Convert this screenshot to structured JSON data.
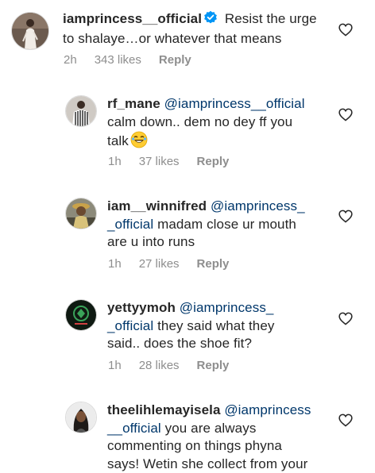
{
  "comments": [
    {
      "username": "iamprincess__official",
      "verified": true,
      "mention": "",
      "text": "Resist the urge to shalaye…or whatever that means",
      "line1_text": "Resist the urge",
      "line2_text": "to shalaye…or whatever that means",
      "time": "2h",
      "likes": "343 likes",
      "reply_label": "Reply",
      "avatar_icon": "profile-photo-woman-white-dress"
    },
    {
      "username": "rf_mane",
      "mention": "@iamprincess__official",
      "line1_text": "calm down.. dem no dey ff you",
      "line2_text": "talk",
      "emoji": "laughing-emoji",
      "time": "1h",
      "likes": "37 likes",
      "reply_label": "Reply",
      "avatar_icon": "profile-photo-man-striped-shirt"
    },
    {
      "username": "iam__winnifred",
      "mention_part1": "@iamprincess_",
      "mention_part2": "_official",
      "line1_text": "madam close ur mouth",
      "line2_text": "are u into runs",
      "time": "1h",
      "likes": "27 likes",
      "reply_label": "Reply",
      "avatar_icon": "profile-photo-person-hat"
    },
    {
      "username": "yettyymoh",
      "mention_part1": "@iamprincess_",
      "mention_part2": "_official",
      "line1_text": "they said what they",
      "line2_text": "said.. does the shoe fit?",
      "time": "1h",
      "likes": "28 likes",
      "reply_label": "Reply",
      "avatar_icon": "profile-photo-dark-logo"
    },
    {
      "username": "theelihlemayisela",
      "mention_part1": "@iamprincess",
      "mention_part2": "__official",
      "line1_text": "you are always",
      "line2_text": "commenting on things phyna",
      "line3_text": "says! Wetin she collect from your",
      "avatar_icon": "profile-photo-woman-portrait"
    }
  ],
  "colors": {
    "text": "#262626",
    "mention": "#00376b",
    "meta": "#8e8e8e",
    "verified": "#0095f6"
  },
  "icons": {
    "like": "heart-outline-icon",
    "verified": "verified-badge-icon"
  }
}
